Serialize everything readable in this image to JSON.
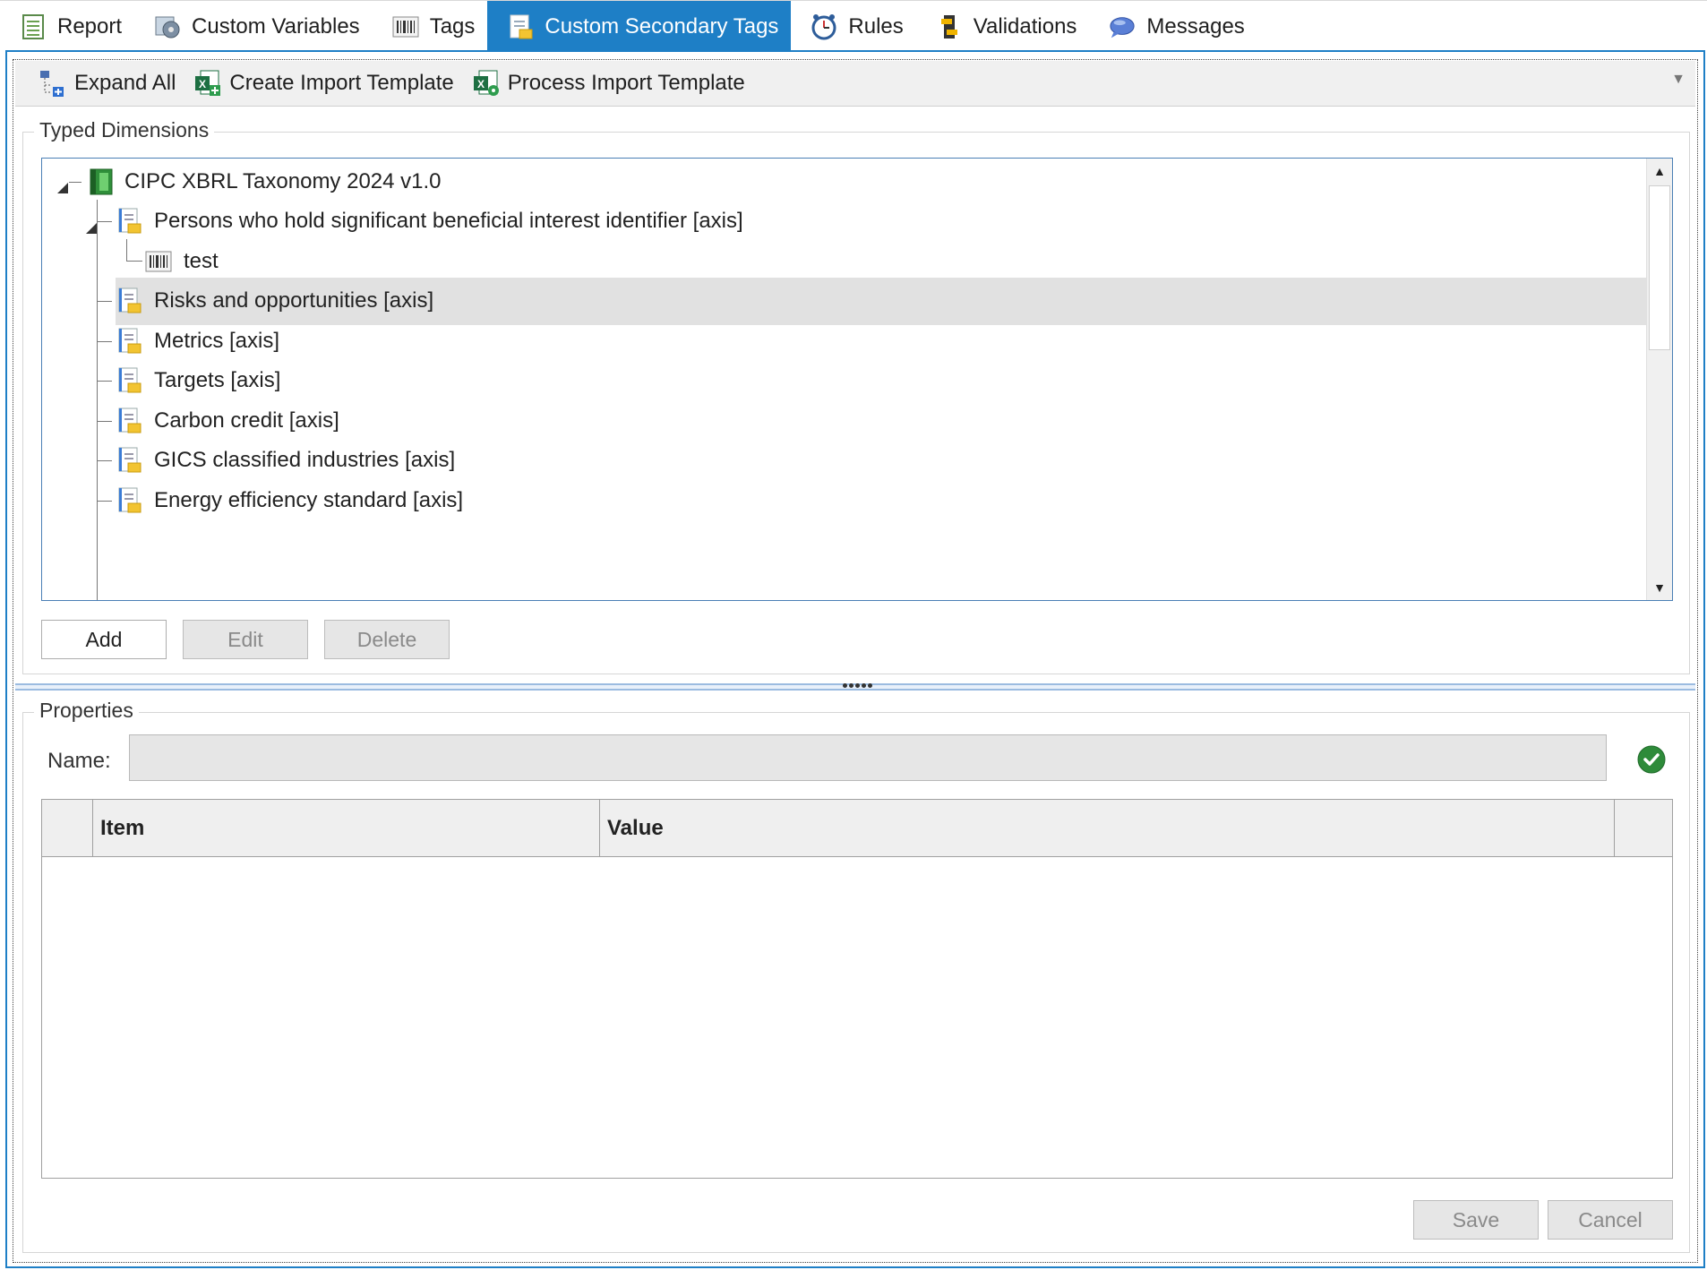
{
  "tabs": [
    {
      "label": "Report",
      "icon": "report-icon"
    },
    {
      "label": "Custom Variables",
      "icon": "variables-icon"
    },
    {
      "label": "Tags",
      "icon": "barcode-icon"
    },
    {
      "label": "Custom Secondary Tags",
      "icon": "secondary-tags-icon",
      "active": true
    },
    {
      "label": "Rules",
      "icon": "clock-icon"
    },
    {
      "label": "Validations",
      "icon": "validation-icon"
    },
    {
      "label": "Messages",
      "icon": "speech-bubble-icon"
    }
  ],
  "toolbar": {
    "expand_all": "Expand All",
    "create_template": "Create Import Template",
    "process_template": "Process Import Template"
  },
  "typed_dimensions": {
    "title": "Typed Dimensions",
    "tree": {
      "root": "CIPC XBRL Taxonomy 2024 v1.0",
      "items": [
        {
          "label": "Persons who hold significant beneficial interest identifier [axis]",
          "expanded": true
        },
        {
          "label": "test"
        },
        {
          "label": "Risks and opportunities [axis]",
          "selected": true
        },
        {
          "label": "Metrics [axis]"
        },
        {
          "label": "Targets [axis]"
        },
        {
          "label": "Carbon credit [axis]"
        },
        {
          "label": "GICS classified industries [axis]"
        },
        {
          "label": "Energy efficiency standard [axis]"
        }
      ]
    },
    "buttons": {
      "add": "Add",
      "edit": "Edit",
      "delete": "Delete"
    }
  },
  "properties": {
    "title": "Properties",
    "name_label": "Name:",
    "name_value": "",
    "columns": [
      "Item",
      "Value"
    ],
    "buttons": {
      "save": "Save",
      "cancel": "Cancel"
    }
  },
  "colors": {
    "accent": "#1e7fc6",
    "selected_row": "#e1e1e1",
    "valid": "#2e8b3a"
  }
}
